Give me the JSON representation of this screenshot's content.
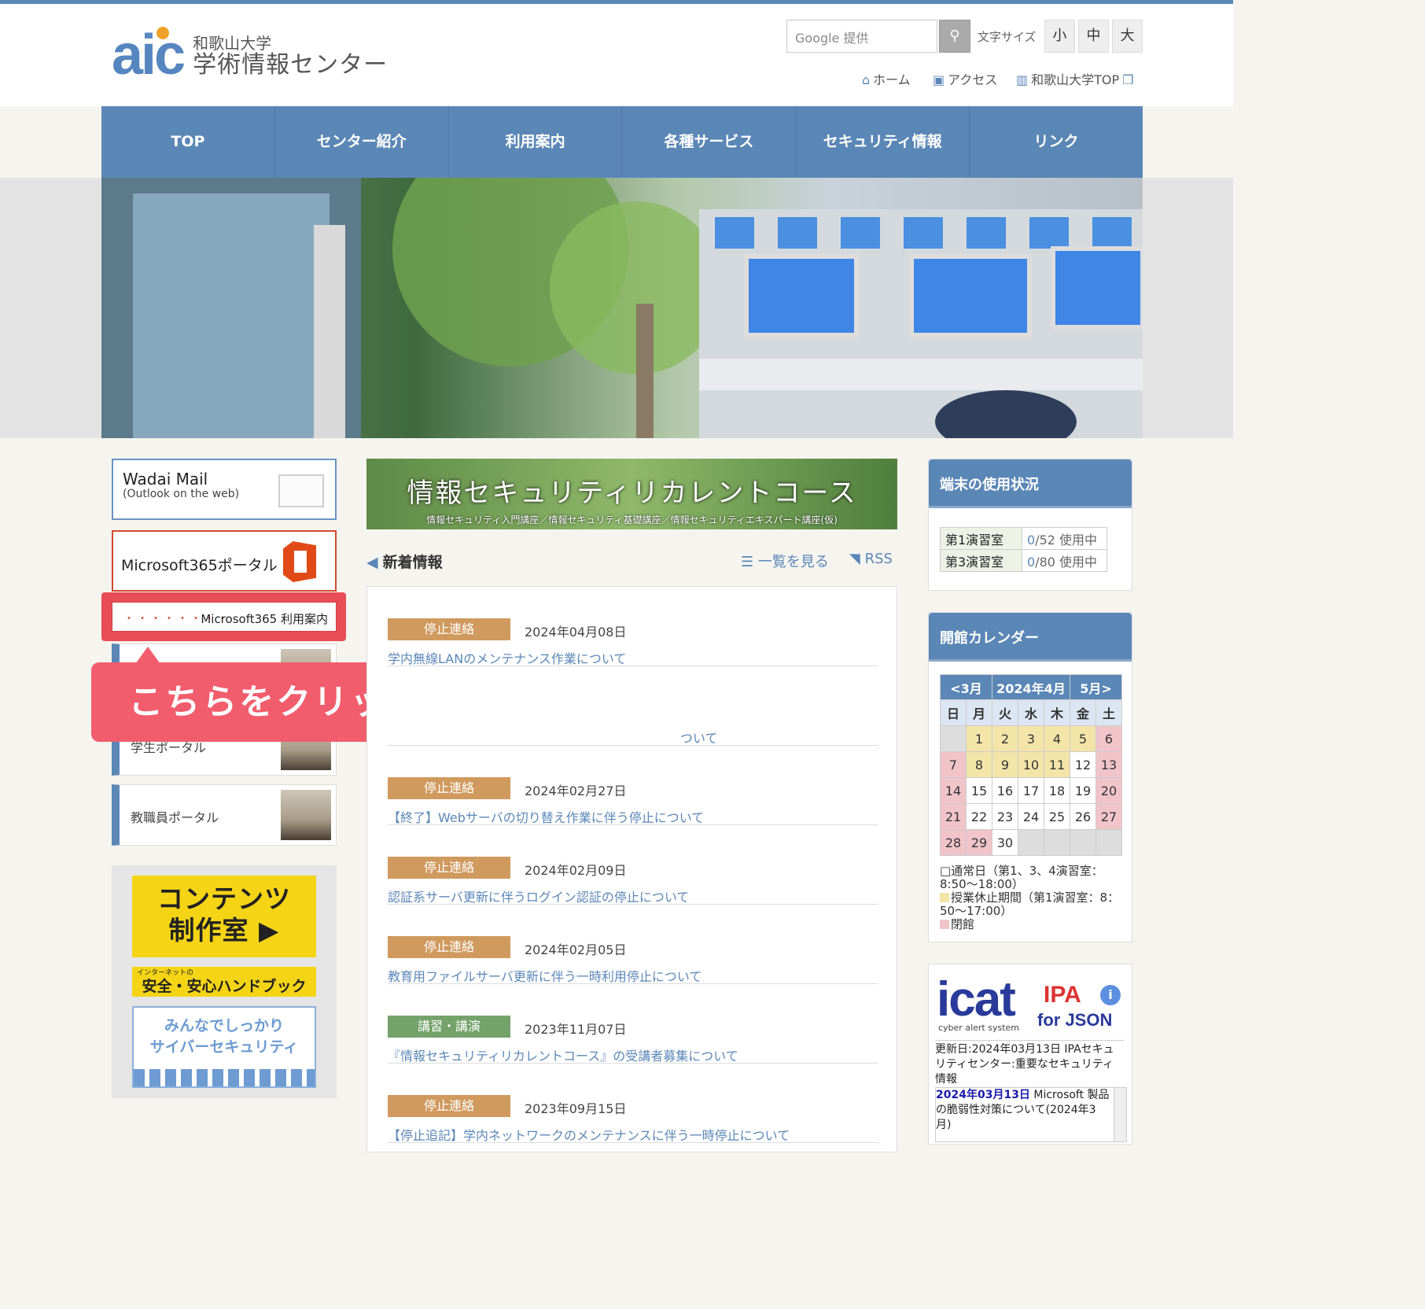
{
  "header": {
    "logo_mark": "aic",
    "logo_line1": "和歌山大学",
    "logo_line2": "学術情報センター",
    "search_placeholder": "Google 提供",
    "search_icon": "magnifier-icon",
    "font_size_label": "文字サイズ",
    "font_sizes": [
      "小",
      "中",
      "大"
    ],
    "util_links": [
      {
        "icon": "home-icon",
        "label": "ホーム"
      },
      {
        "icon": "train-icon",
        "label": "アクセス"
      },
      {
        "icon": "building-icon",
        "label": "和歌山大学TOP"
      }
    ]
  },
  "nav": [
    "TOP",
    "センター紹介",
    "利用案内",
    "各種サービス",
    "セキュリティ情報",
    "リンク"
  ],
  "left": {
    "mail_title": "Wadai Mail",
    "mail_sub": "(Outlook on the web)",
    "ms365": "Microsoft365ポータル",
    "ms365_guide": "Microsoft365 利用案内",
    "ms365_guide_dots": "・・・・・・・・",
    "student_portal": "学生ポータル",
    "staff_portal": "教職員ポータル",
    "banner1_line1": "コンテンツ",
    "banner1_line2": "制作室",
    "banner2_small": "インターネットの",
    "banner2_main": "安全・安心ハンドブック",
    "banner3_line1": "みんなでしっかり",
    "banner3_line2": "サイバーセキュリティ"
  },
  "callout": "こちらをクリックしてください",
  "center": {
    "banner_title": "情報セキュリティリカレントコース",
    "banner_sub": "情報セキュリティ入門講座／情報セキュリティ基礎講座／情報セキュリティエキスパート講座(仮)",
    "news_title": "新着情報",
    "list_link": "一覧を見る",
    "rss_link": "RSS",
    "news": [
      {
        "tag": "停止連絡",
        "date": "2024年04月08日",
        "title": "学内無線LANのメンテナンス作業について"
      },
      {
        "tag": "",
        "date": "",
        "title": "ついて"
      },
      {
        "tag": "停止連絡",
        "date": "2024年02月27日",
        "title": "【終了】Webサーバの切り替え作業に伴う停止について"
      },
      {
        "tag": "停止連絡",
        "date": "2024年02月09日",
        "title": "認証系サーバ更新に伴うログイン認証の停止について"
      },
      {
        "tag": "停止連絡",
        "date": "2024年02月05日",
        "title": "教育用ファイルサーバ更新に伴う一時利用停止について"
      },
      {
        "tag": "講習・講演",
        "date": "2023年11月07日",
        "title": "『情報セキュリティリカレントコース』の受講者募集について"
      },
      {
        "tag": "停止連絡",
        "date": "2023年09月15日",
        "title": "【停止追記】学内ネットワークのメンテナンスに伴う一時停止について"
      }
    ]
  },
  "right": {
    "usage_title": "端末の使用状況",
    "rooms": [
      {
        "name": "第1演習室",
        "used": "0",
        "total": "/52 使用中"
      },
      {
        "name": "第3演習室",
        "used": "0",
        "total": "/80 使用中"
      }
    ],
    "cal_title": "開館カレンダー",
    "cal_prev": "<3月",
    "cal_month": "2024年4月",
    "cal_next": "5月>",
    "weekdays": [
      "日",
      "月",
      "火",
      "水",
      "木",
      "金",
      "土"
    ],
    "legend1": "□通常日（第1、3、4演習室：8:50～18:00）",
    "legend2": "授業休止期間（第1演習室：8：50～17:00）",
    "legend3": "閉館",
    "icat_logo": "icat",
    "icat_sub": "cyber alert system",
    "icat_ipa": "IPA",
    "icat_json": "for JSON",
    "icat_updated": "更新日:2024年03月13日 IPAセキュリティセンター:重要なセキュリティ情報",
    "icat_item_date": "2024年03月13日",
    "icat_item_text": " Microsoft 製品の脆弱性対策について(2024年3月)"
  }
}
